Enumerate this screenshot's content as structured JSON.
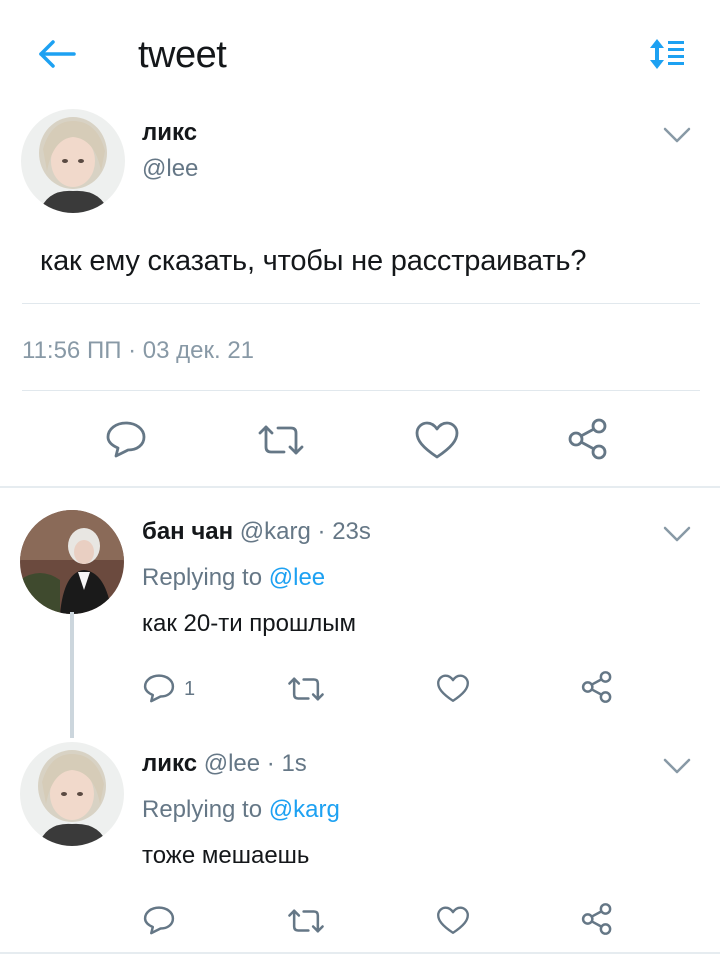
{
  "header": {
    "title": "tweet",
    "back_icon": "arrow-left-icon",
    "sort_icon": "sort-list-icon",
    "accent": "#1da1f2"
  },
  "main_tweet": {
    "name": "ликс",
    "handle": "@lee",
    "text": "как ему сказать, чтобы не расстраивать?",
    "timestamp": "11:56 ПП · 03 дек. 21"
  },
  "replies": [
    {
      "name": "бан чан",
      "handle": "@karg",
      "time": "23s",
      "replying_label": "Replying to",
      "replying_to": "@lee",
      "text": "как 20-ти прошлым",
      "reply_count": "1"
    },
    {
      "name": "ликс",
      "handle": "@lee",
      "time": "1s",
      "replying_label": "Replying to",
      "replying_to": "@karg",
      "text": "тоже мешаешь",
      "reply_count": ""
    }
  ],
  "colors": {
    "mention": "#1da1f2",
    "secondary_text": "#657786",
    "divider": "#e1e8ed"
  }
}
